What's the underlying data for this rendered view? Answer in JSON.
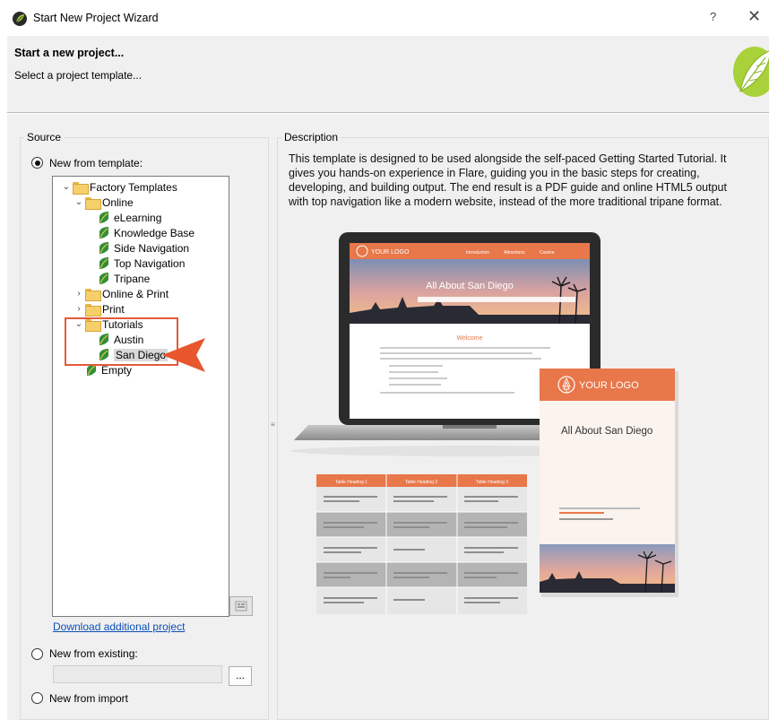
{
  "window": {
    "title": "Start New Project Wizard",
    "help": "?",
    "close": "✕"
  },
  "header": {
    "title": "Start a new project...",
    "subtitle": "Select a project template..."
  },
  "source": {
    "label": "Source",
    "new_from_template": "New from template:",
    "tree": {
      "factory": "Factory Templates",
      "online": "Online",
      "elearning": "eLearning",
      "knowledge_base": "Knowledge Base",
      "side_navigation": "Side Navigation",
      "top_navigation": "Top Navigation",
      "tripane": "Tripane",
      "online_print": "Online & Print",
      "print": "Print",
      "tutorials": "Tutorials",
      "austin": "Austin",
      "san_diego": "San Diego",
      "empty": "Empty"
    },
    "download_link": "Download additional project",
    "new_from_existing": "New from existing:",
    "browse": "...",
    "new_from_import": "New from import"
  },
  "description": {
    "label": "Description",
    "text": "This template is designed to be used alongside the self-paced Getting Started Tutorial. It gives you hands-on experience in Flare, guiding you in the basic steps for creating, developing, and building output. The end result is a PDF guide and online HTML5 output with top navigation like a modern website, instead of the more traditional tripane format."
  },
  "preview": {
    "laptop_logo": "YOUR LOGO",
    "nav": [
      "Introduction",
      "Attractions",
      "Cuisine"
    ],
    "hero_title": "All About San Diego",
    "welcome": "Welcome",
    "pdf_logo": "YOUR LOGO",
    "pdf_title": "All About San Diego",
    "table_headers": [
      "Table Heading 1",
      "Table Heading 2",
      "Table Heading 3"
    ]
  },
  "colors": {
    "accent": "#e8774a",
    "highlight": "#e25a3a",
    "link": "#0b4fb6",
    "panel_bg": "#f0f0f0"
  }
}
